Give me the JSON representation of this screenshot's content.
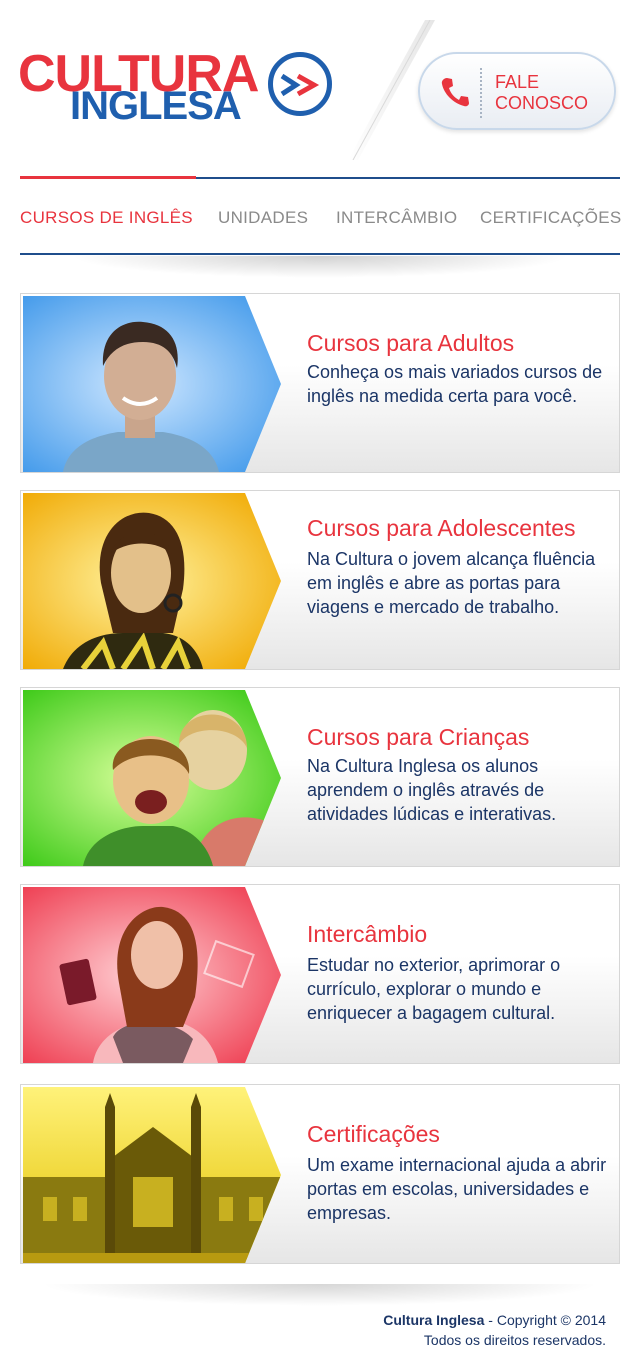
{
  "header": {
    "logo_line1": "CULTURA",
    "logo_line2": "INGLESA",
    "contact_line1": "FALE",
    "contact_line2": "CONOSCO"
  },
  "nav": {
    "items": [
      {
        "label": "CURSOS DE INGLÊS",
        "active": true
      },
      {
        "label": "UNIDADES",
        "active": false
      },
      {
        "label": "INTERCÂMBIO",
        "active": false
      },
      {
        "label": "CERTIFICAÇÕES",
        "active": false
      }
    ]
  },
  "cards": [
    {
      "title": "Cursos para Adultos",
      "description": "Conheça os mais variados cursos de inglês na medida certa para você.",
      "image_color": "#5aa9ee"
    },
    {
      "title": "Cursos para Adolescentes",
      "description": "Na Cultura o jovem alcança fluência em inglês e abre as portas para viagens e mercado de trabalho.",
      "image_color": "#f2b400"
    },
    {
      "title": "Cursos para Crianças",
      "description": "Na Cultura Inglesa os alunos aprendem o inglês através de atividades lúdicas e interativas.",
      "image_color": "#4fd21a"
    },
    {
      "title": "Intercâmbio",
      "description": "Estudar no exterior, aprimorar o currículo, explorar o mundo e enriquecer a bagagem cultural.",
      "image_color": "#f0485a"
    },
    {
      "title": "Certificações",
      "description": "Um exame internacional ajuda a abrir portas em escolas, universidades e empresas.",
      "image_color": "#e6c400"
    }
  ],
  "footer": {
    "brand": "Cultura Inglesa",
    "copyright": " - Copyright © 2014",
    "rights": "Todos os direitos reservados."
  },
  "colors": {
    "brand_red": "#e8343e",
    "brand_blue": "#1f5fae",
    "text_navy": "#1b3566"
  },
  "icons": [
    "logo-arrows-icon",
    "phone-icon"
  ]
}
